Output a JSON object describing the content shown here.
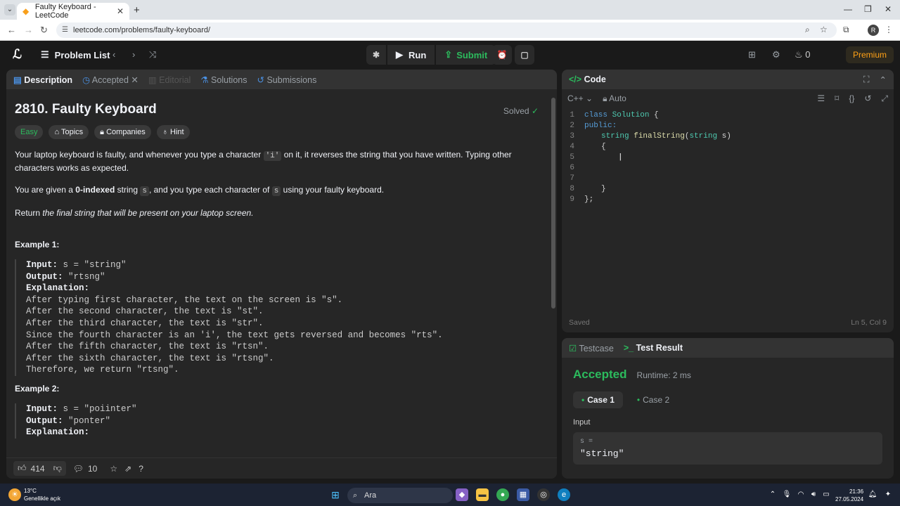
{
  "browser": {
    "tab_title": "Faulty Keyboard - LeetCode",
    "url": "leetcode.com/problems/faulty-keyboard/",
    "avatar": "R"
  },
  "topbar": {
    "problem_list": "Problem List",
    "run": "Run",
    "submit": "Submit",
    "streak": "0",
    "premium": "Premium"
  },
  "left": {
    "tabs": {
      "description": "Description",
      "accepted": "Accepted",
      "editorial": "Editorial",
      "solutions": "Solutions",
      "submissions": "Submissions"
    },
    "title": "2810. Faulty Keyboard",
    "solved": "Solved",
    "tags": {
      "easy": "Easy",
      "topics": "Topics",
      "companies": "Companies",
      "hint": "Hint"
    },
    "p1a": "Your laptop keyboard is faulty, and whenever you type a character ",
    "p1code": "'i'",
    "p1b": " on it, it reverses the string that you have written. Typing other characters works as expected.",
    "p2a": "You are given a ",
    "p2b": "0-indexed",
    "p2c": " string ",
    "p2code1": "s",
    "p2d": ", and you type each character of ",
    "p2code2": "s",
    "p2e": " using your faulty keyboard.",
    "p3a": "Return ",
    "p3b": "the final string that will be present on your laptop screen.",
    "ex1_title": "Example 1:",
    "ex1": {
      "input_label": "Input:",
      "input": " s = \"string\"",
      "output_label": "Output:",
      "output": " \"rtsng\"",
      "expl_label": "Explanation:",
      "lines": [
        "After typing first character, the text on the screen is \"s\".",
        "After the second character, the text is \"st\".",
        "After the third character, the text is \"str\".",
        "Since the fourth character is an 'i', the text gets reversed and becomes \"rts\".",
        "After the fifth character, the text is \"rtsn\".",
        "After the sixth character, the text is \"rtsng\".",
        "Therefore, we return \"rtsng\"."
      ]
    },
    "ex2_title": "Example 2:",
    "ex2": {
      "input_label": "Input:",
      "input": " s = \"poiinter\"",
      "output_label": "Output:",
      "output": " \"ponter\"",
      "expl_label": "Explanation:"
    },
    "footer": {
      "likes": "414",
      "comments": "10"
    }
  },
  "code": {
    "title": "Code",
    "lang": "C++",
    "auto": "Auto",
    "saved": "Saved",
    "cursor": "Ln 5, Col 9",
    "lines": [
      {
        "n": "1"
      },
      {
        "n": "2"
      },
      {
        "n": "3"
      },
      {
        "n": "4"
      },
      {
        "n": "5"
      },
      {
        "n": "6"
      },
      {
        "n": "7"
      },
      {
        "n": "8"
      },
      {
        "n": "9"
      }
    ],
    "src": {
      "l1a": "class",
      "l1b": "Solution",
      "l1c": " {",
      "l2": "public:",
      "l3a": "string",
      "l3b": "finalString",
      "l3c": "(",
      "l3d": "string",
      "l3e": " s)",
      "l4": "{",
      "l8": "}",
      "l9": "};"
    }
  },
  "result": {
    "tab_testcase": "Testcase",
    "tab_result": "Test Result",
    "status": "Accepted",
    "runtime": "Runtime: 2 ms",
    "case1": "Case 1",
    "case2": "Case 2",
    "input_label": "Input",
    "var": "s =",
    "value": "\"string\""
  },
  "taskbar": {
    "temp": "13°C",
    "weather": "Genellikle açık",
    "search": "Ara",
    "time": "21:36",
    "date": "27.05.2024"
  }
}
